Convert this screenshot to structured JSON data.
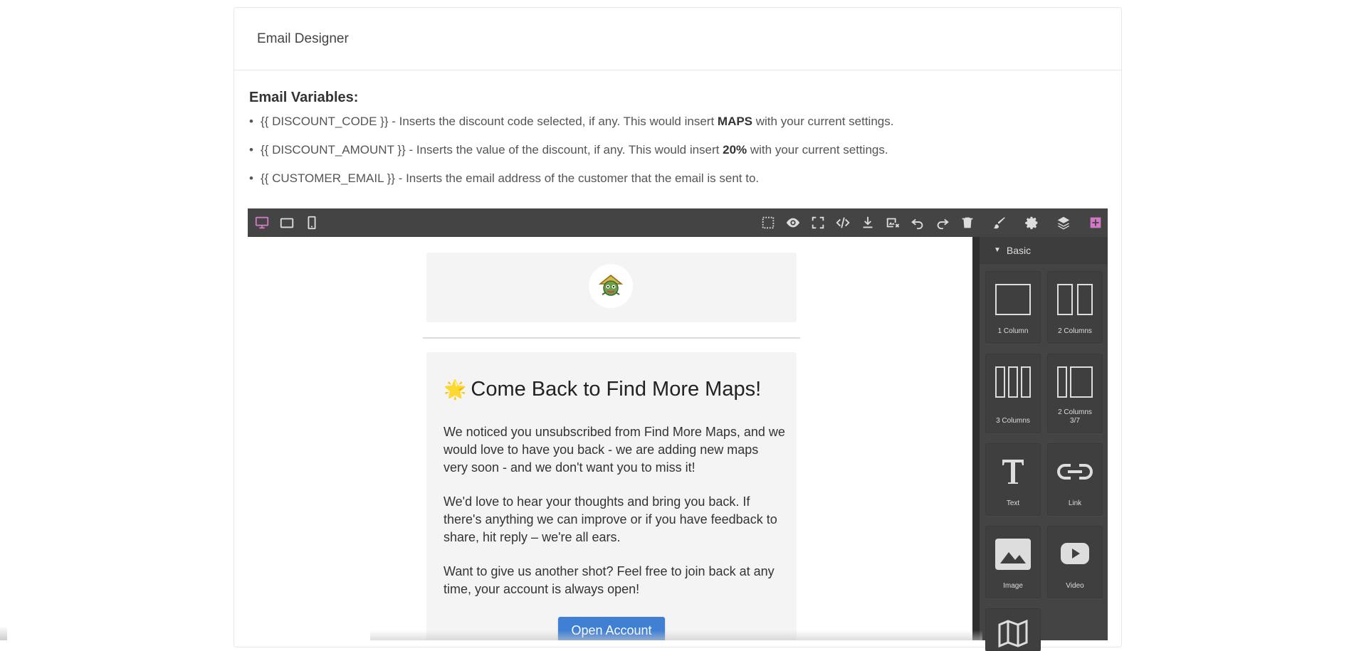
{
  "card": {
    "title": "Email Designer"
  },
  "variables": {
    "heading": "Email Variables:",
    "items": [
      {
        "code": "{{ DISCOUNT_CODE }}",
        "text_before": " - Inserts the discount code selected, if any. This would insert ",
        "value": "MAPS",
        "text_after": " with your current settings."
      },
      {
        "code": "{{ DISCOUNT_AMOUNT }}",
        "text_before": " - Inserts the value of the discount, if any. This would insert ",
        "value": "20%",
        "text_after": " with your current settings."
      },
      {
        "code": "{{ CUSTOMER_EMAIL }}",
        "text_before": " - Inserts the email address of the customer that the email is sent to.",
        "value": "",
        "text_after": ""
      }
    ]
  },
  "toolbar": {
    "devices": [
      "desktop-icon",
      "tablet-icon",
      "mobile-icon"
    ],
    "actions": [
      "select-outline-icon",
      "preview-eye-icon",
      "fullscreen-icon",
      "code-icon",
      "download-icon",
      "image-remove-icon",
      "undo-icon",
      "redo-icon",
      "trash-icon"
    ],
    "panels": [
      "brush-icon",
      "settings-icon",
      "layers-icon",
      "blocks-icon"
    ],
    "accent": "#d278c9"
  },
  "panel": {
    "category": "Basic",
    "blocks": [
      {
        "label": "1 Column",
        "icon": "one-column-icon"
      },
      {
        "label": "2 Columns",
        "icon": "two-columns-icon"
      },
      {
        "label": "3 Columns",
        "icon": "three-columns-icon"
      },
      {
        "label": "2 Columns 3/7",
        "icon": "two-columns-3-7-icon"
      },
      {
        "label": "Text",
        "icon": "text-icon"
      },
      {
        "label": "Link",
        "icon": "link-icon"
      },
      {
        "label": "Image",
        "icon": "image-icon"
      },
      {
        "label": "Video",
        "icon": "video-icon"
      },
      {
        "label": "",
        "icon": "map-icon"
      }
    ]
  },
  "email": {
    "title_star": "🌟",
    "title": "Come Back to Find More Maps!",
    "paragraphs": [
      "We noticed you unsubscribed from Find More Maps, and we would love to have you back - we are adding new maps very soon - and we don't want you to miss it!",
      "We'd love to hear your thoughts and bring you back. If there's anything we can improve or if you have feedback to share, hit reply – we're all ears.",
      "Want to give us another shot? Feel free to join back at any time, your account is always open!"
    ],
    "button": "Open Account",
    "button_color": "#3f7fd4"
  }
}
